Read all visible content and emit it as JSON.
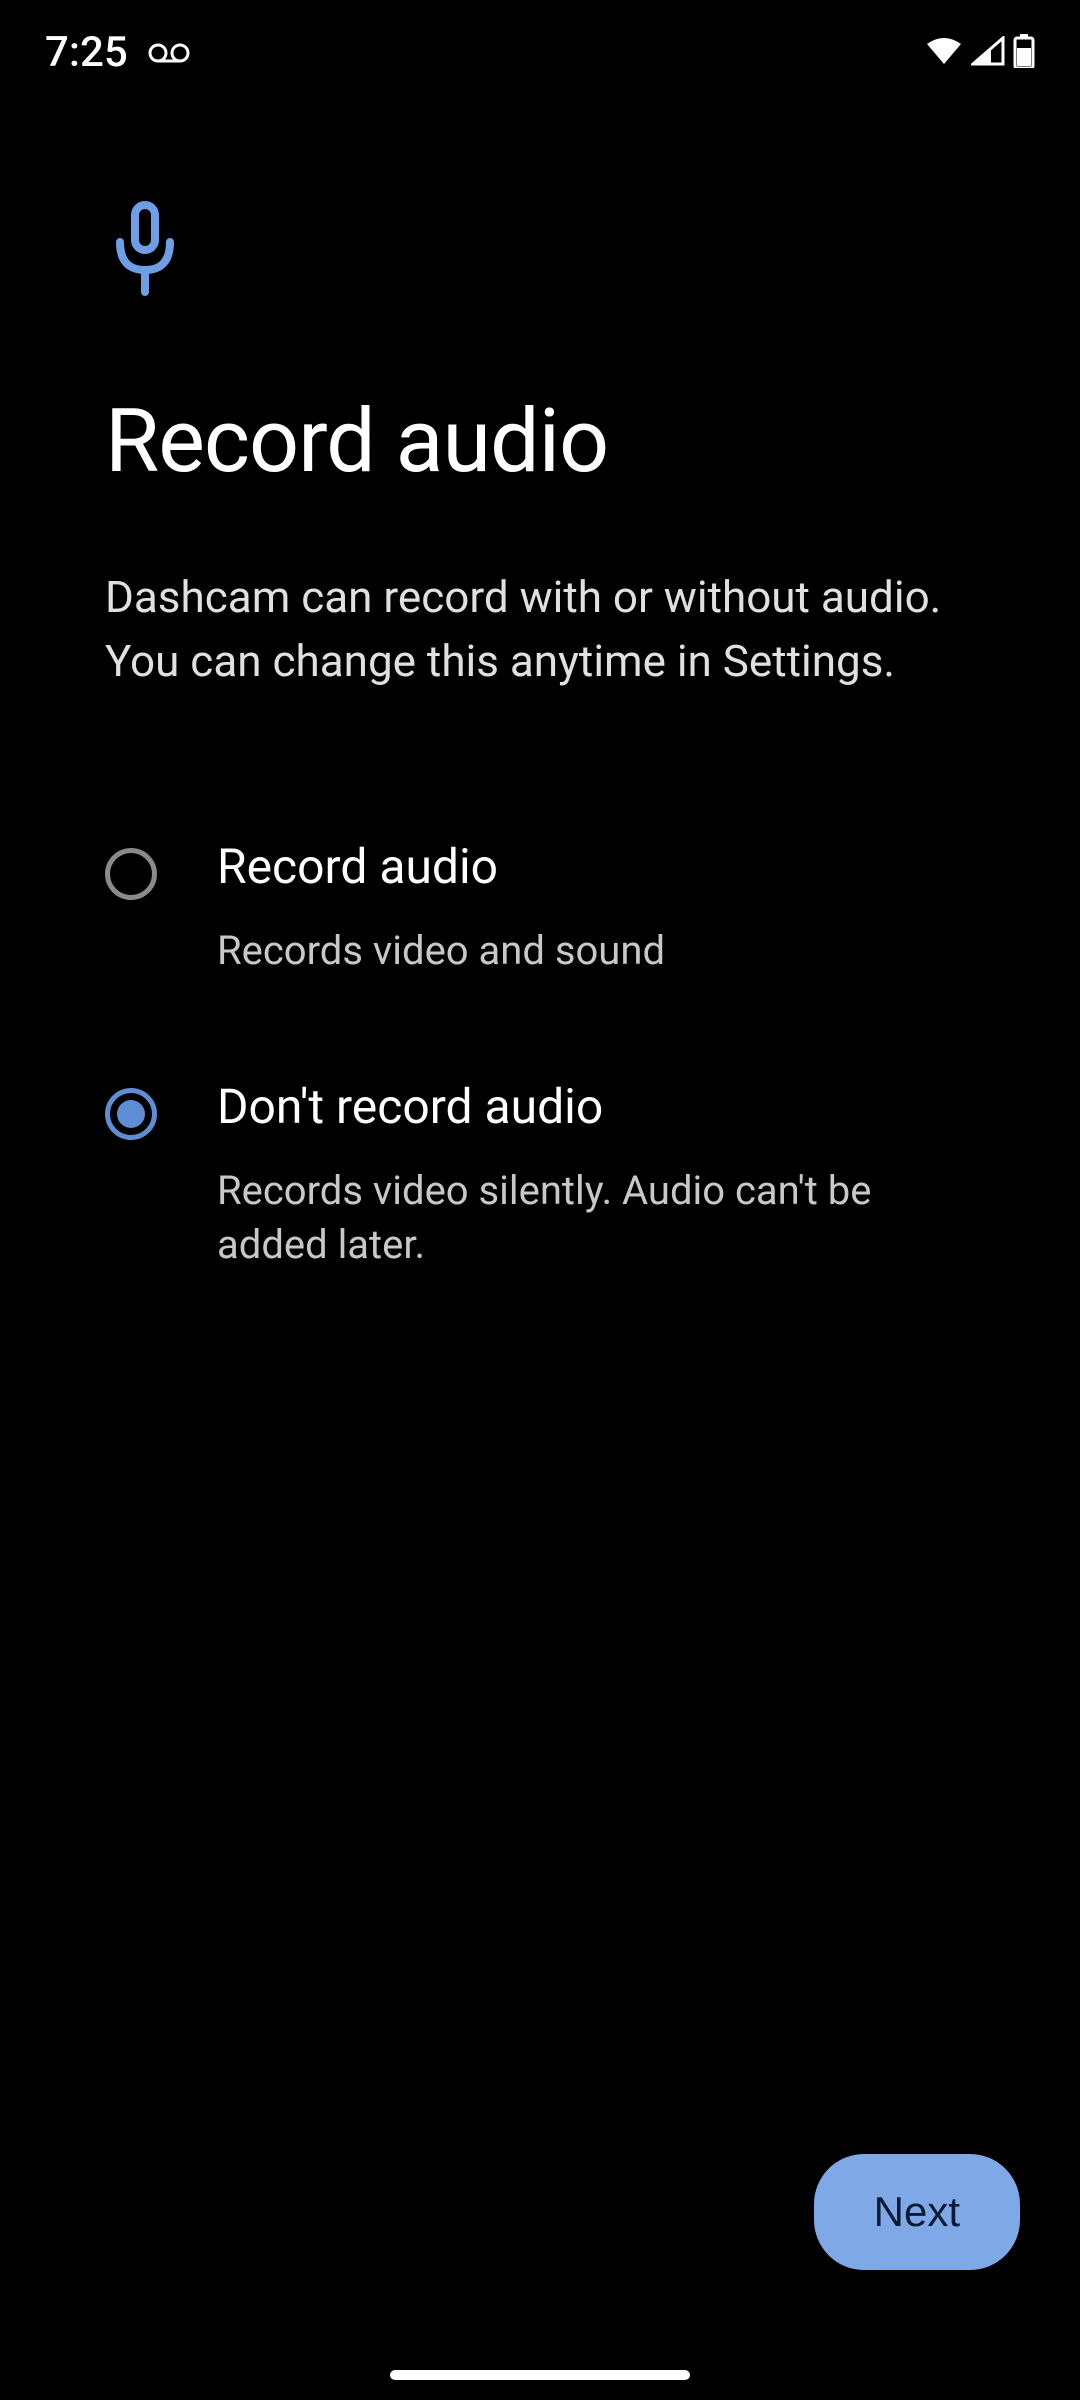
{
  "status_bar": {
    "time": "7:25"
  },
  "header": {
    "title": "Record audio",
    "description": "Dashcam can record with or without audio. You can change this anytime in Settings."
  },
  "options": [
    {
      "label": "Record audio",
      "sublabel": "Records video and sound",
      "selected": false
    },
    {
      "label": "Don't record audio",
      "sublabel": "Records video silently. Audio can't be added later.",
      "selected": true
    }
  ],
  "footer": {
    "next_label": "Next"
  },
  "colors": {
    "accent": "#7ea8e6",
    "radio_selected": "#5f8dd3",
    "background": "#000000"
  }
}
